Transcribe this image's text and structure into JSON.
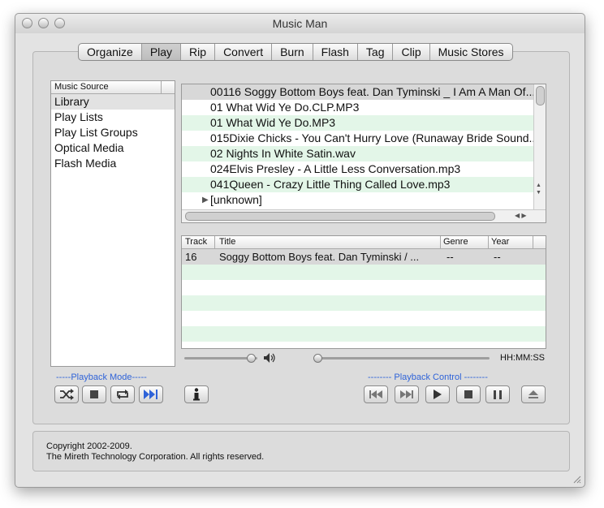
{
  "window": {
    "title": "Music Man"
  },
  "tabs": [
    "Organize",
    "Play",
    "Rip",
    "Convert",
    "Burn",
    "Flash",
    "Tag",
    "Clip",
    "Music Stores"
  ],
  "active_tab": "Play",
  "music_source": {
    "header": "Music Source",
    "items": [
      "Library",
      "Play Lists",
      "Play List Groups",
      "Optical Media",
      "Flash Media"
    ],
    "selected": "Library"
  },
  "files": [
    "00116 Soggy Bottom Boys feat. Dan Tyminski _ I Am A Man Of...",
    "01 What Wid Ye Do.CLP.MP3",
    "01 What Wid Ye Do.MP3",
    "015Dixie Chicks - You Can't Hurry Love (Runaway Bride Sound...",
    "02 Nights In White Satin.wav",
    "024Elvis Presley - A Little Less Conversation.mp3",
    "041Queen - Crazy Little Thing Called Love.mp3",
    "[unknown]"
  ],
  "track_table": {
    "columns": [
      "Track",
      "Title",
      "Genre",
      "Year"
    ],
    "rows": [
      {
        "track": "16",
        "title": "Soggy Bottom Boys feat. Dan Tyminski / ...",
        "genre": "--",
        "year": "--"
      }
    ]
  },
  "playback": {
    "time": "HH:MM:SS",
    "mode_label": "-----Playback Mode-----",
    "control_label": "-------- Playback Control --------"
  },
  "footer": {
    "line1": "Copyright 2002-2009.",
    "line2": "The Mireth Technology Corporation. All rights reserved."
  },
  "icons": {
    "shuffle": "shuffle-icon",
    "stop": "stop-icon",
    "repeat": "repeat-icon",
    "next": "next-icon",
    "info": "info-icon",
    "prev": "previous-icon",
    "play": "play-icon",
    "pause": "pause-icon",
    "eject": "eject-icon",
    "volume": "speaker-icon"
  },
  "colors": {
    "row_alt": "#e3f6e8",
    "accent": "#2f63d8"
  }
}
